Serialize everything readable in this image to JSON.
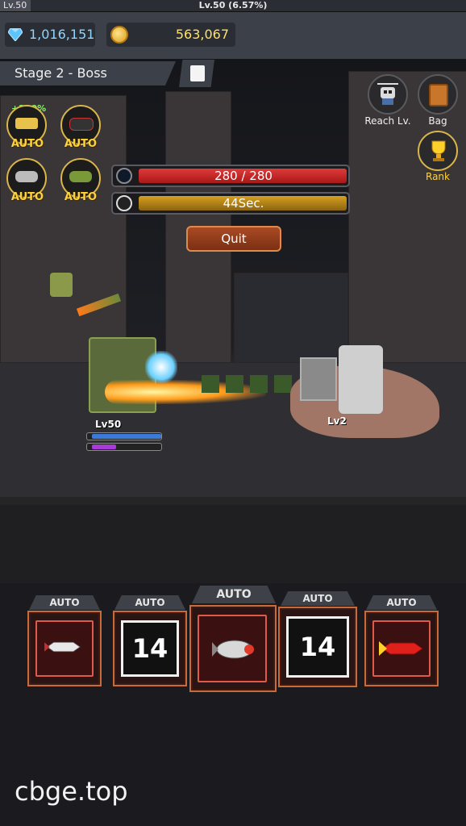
{
  "top_bar": {
    "level_left": "Lv.50",
    "level_center": "Lv.50 (6.57%)",
    "xp_percent": 6.57
  },
  "currency": {
    "gems": "1,016,151",
    "gold": "563,067"
  },
  "stage": {
    "label": "Stage 2 - Boss"
  },
  "skills": [
    {
      "icon": "gold-gun-icon",
      "label": "AUTO",
      "buff": "+200%"
    },
    {
      "icon": "bullet-icon",
      "label": "AUTO"
    },
    {
      "icon": "drone-icon",
      "label": "AUTO"
    },
    {
      "icon": "soldier-icon",
      "label": "AUTO"
    }
  ],
  "right_menu": {
    "reach_label": "Reach Lv.",
    "bag_label": "Bag",
    "rank_label": "Rank"
  },
  "boss": {
    "hp_text": "280 / 280",
    "hp_fraction": 1.0,
    "time_text": "44Sec.",
    "time_fraction": 1.0,
    "level": "Lv2"
  },
  "quit_label": "Quit",
  "hero": {
    "level": "Lv50",
    "hp_fraction": 1.0,
    "mp_fraction": 0.35
  },
  "weapons": [
    {
      "tag": "AUTO",
      "type": "rocket",
      "value": ""
    },
    {
      "tag": "AUTO",
      "type": "count",
      "value": "14"
    },
    {
      "tag": "AUTO",
      "type": "rocket",
      "value": ""
    },
    {
      "tag": "AUTO",
      "type": "count",
      "value": "14"
    },
    {
      "tag": "AUTO",
      "type": "rocket",
      "value": ""
    }
  ],
  "watermark": "cbge.top",
  "colors": {
    "hp": "#c8222a",
    "time": "#b8860b",
    "gem": "#5ec4ff",
    "gold": "#ffd23a"
  }
}
